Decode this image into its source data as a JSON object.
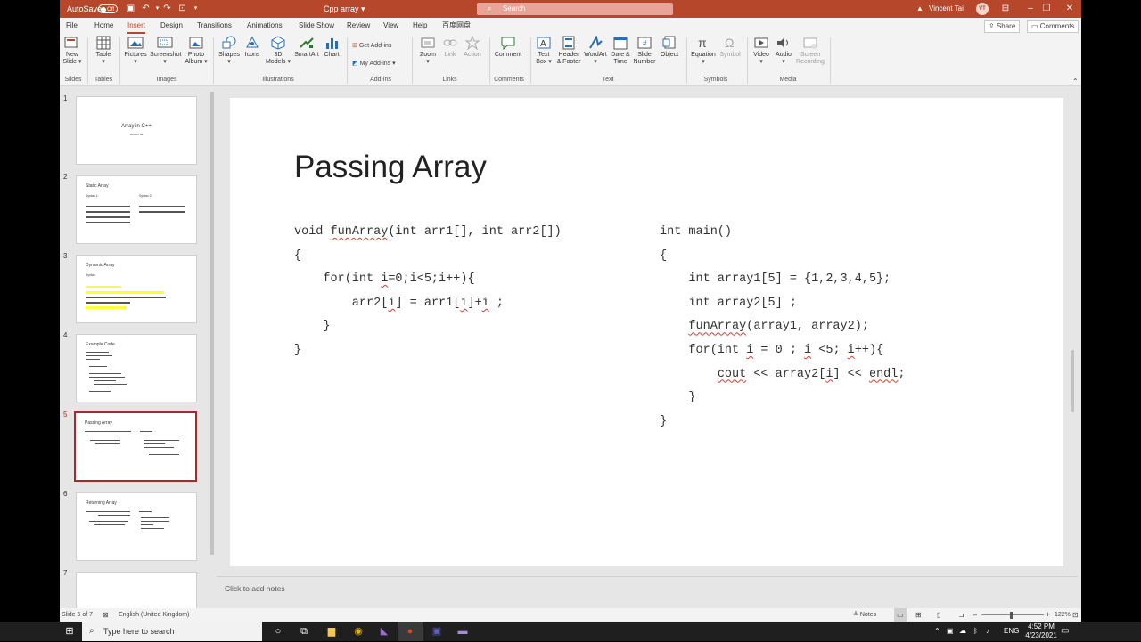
{
  "titlebar": {
    "autosave_label": "AutoSave",
    "autosave_state": "Off",
    "doc_title": "Cpp array",
    "search_placeholder": "Search",
    "user_name": "Vincent Tai",
    "user_initials": "VT"
  },
  "tabs": [
    "File",
    "Home",
    "Insert",
    "Design",
    "Transitions",
    "Animations",
    "Slide Show",
    "Review",
    "View",
    "Help",
    "百度网盘"
  ],
  "active_tab": "Insert",
  "share_label": "Share",
  "comments_label": "Comments",
  "ribbon": {
    "new_slide": [
      "New",
      "Slide"
    ],
    "table": "Table",
    "pictures": "Pictures",
    "screenshot": "Screenshot",
    "photo_album": [
      "Photo",
      "Album"
    ],
    "shapes": "Shapes",
    "icons": "Icons",
    "models_3d": [
      "3D",
      "Models"
    ],
    "smartart": "SmartArt",
    "chart": "Chart",
    "get_addins": "Get Add-ins",
    "my_addins": "My Add-ins",
    "zoom": "Zoom",
    "link": "Link",
    "action": "Action",
    "comment": "Comment",
    "text_box": [
      "Text",
      "Box"
    ],
    "header_footer": [
      "Header",
      "& Footer"
    ],
    "wordart": "WordArt",
    "date_time": [
      "Date &",
      "Time"
    ],
    "slide_number": [
      "Slide",
      "Number"
    ],
    "object": "Object",
    "equation": "Equation",
    "symbol": "Symbol",
    "video": "Video",
    "audio": "Audio",
    "screen_recording": [
      "Screen",
      "Recording"
    ],
    "groups": {
      "slides": "Slides",
      "tables": "Tables",
      "images": "Images",
      "illustrations": "Illustrations",
      "addins": "Add-ins",
      "links": "Links",
      "comments": "Comments",
      "text": "Text",
      "symbols": "Symbols",
      "media": "Media"
    }
  },
  "thumbnails": [
    {
      "num": "1",
      "title": "Array in C++",
      "subtitle": "Vincent Tai"
    },
    {
      "num": "2",
      "title": "Static Array",
      "col1": "Syntax 1:",
      "col2": "Syntax 2:"
    },
    {
      "num": "3",
      "title": "Dynamic Array",
      "sub": "Syntax"
    },
    {
      "num": "4",
      "title": "Example Code"
    },
    {
      "num": "5",
      "title": "Passing Array"
    },
    {
      "num": "6",
      "title": "Returning Array"
    },
    {
      "num": "7",
      "title": ""
    }
  ],
  "slide": {
    "title": "Passing Array",
    "left_code": {
      "line1_a": "void ",
      "line1_b": "funArray",
      "line1_c": "(int arr1[], int arr2[])",
      "line2": "{",
      "line3_a": "    for(int ",
      "line3_b": "i",
      "line3_c": "=0;i<5;i++){",
      "line4_a": "        arr2[",
      "line4_b": "i",
      "line4_c": "] = arr1[",
      "line4_d": "i",
      "line4_e": "]+",
      "line4_f": "i",
      "line4_g": " ;",
      "line5": "    }",
      "line6": "}"
    },
    "right_code": {
      "line1": "int main()",
      "line2": "{",
      "line3": "    int array1[5] = {1,2,3,4,5};",
      "line4": "    int array2[5] ;",
      "line5_a": "    ",
      "line5_b": "funArray",
      "line5_c": "(array1, array2);",
      "line6_a": "    for(int ",
      "line6_b": "i",
      "line6_c": " = 0 ; ",
      "line6_d": "i",
      "line6_e": " <5; ",
      "line6_f": "i",
      "line6_g": "++){",
      "line7_a": "        ",
      "line7_b": "cout",
      "line7_c": " << array2[",
      "line7_d": "i",
      "line7_e": "] << ",
      "line7_f": "endl",
      "line7_g": ";",
      "line8": "    }",
      "line9": "}"
    }
  },
  "notes_placeholder": "Click to add notes",
  "status": {
    "slide_info": "Slide 5 of 7",
    "language": "English (United Kingdom)",
    "notes": "Notes",
    "zoom": "122%"
  },
  "taskbar": {
    "search_placeholder": "Type here to search",
    "lang": "ENG",
    "time": "4:52 PM",
    "date": "4/23/2021"
  },
  "colors": {
    "accent": "#b7472a",
    "selected_border": "#a52a2a",
    "spell_squiggle": "#d04030"
  }
}
